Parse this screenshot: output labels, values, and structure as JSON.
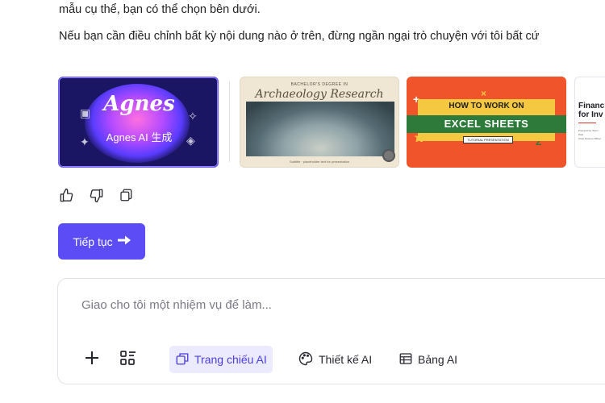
{
  "messages": {
    "line1": "mẫu cụ thể, bạn có thể chọn bên dưới.",
    "line2": "Nếu bạn cần điều chỉnh bất kỳ nội dung nào ở trên, đừng ngần ngại trò chuyện với tôi bất cứ"
  },
  "templates": [
    {
      "logo": "Agnes",
      "subtitle": "Agnes AI 生成"
    },
    {
      "kicker": "BACHELOR'S DEGREE IN",
      "title": "Archaeology Research",
      "footer": "Subtitle · placeholder text for presentation"
    },
    {
      "title": "HOW TO WORK ON",
      "subtitle": "EXCEL SHEETS",
      "tag": "TUTORIAL PRESENTATION"
    },
    {
      "title_line1": "Financ",
      "title_line2": "for Inv",
      "meta_line1": "Prepared by Team",
      "meta_line2": "Date",
      "meta_line3": "Chief Finance Officer"
    }
  ],
  "feedback": {
    "like_icon": "thumbs-up-icon",
    "dislike_icon": "thumbs-down-icon",
    "copy_icon": "copy-icon"
  },
  "continue_button": {
    "label": "Tiếp tục",
    "icon": "arrow-right-icon"
  },
  "composer": {
    "placeholder": "Giao cho tôi một nhiệm vụ để làm...",
    "tools": [
      {
        "label": "Trang chiếu AI",
        "icon": "slides-icon",
        "active": true
      },
      {
        "label": "Thiết kế AI",
        "icon": "palette-icon",
        "active": false
      },
      {
        "label": "Bảng AI",
        "icon": "table-icon",
        "active": false
      }
    ]
  },
  "colors": {
    "accent": "#5b4cf5",
    "active_chip_bg": "#eceaff",
    "active_chip_text": "#4a3de0"
  }
}
